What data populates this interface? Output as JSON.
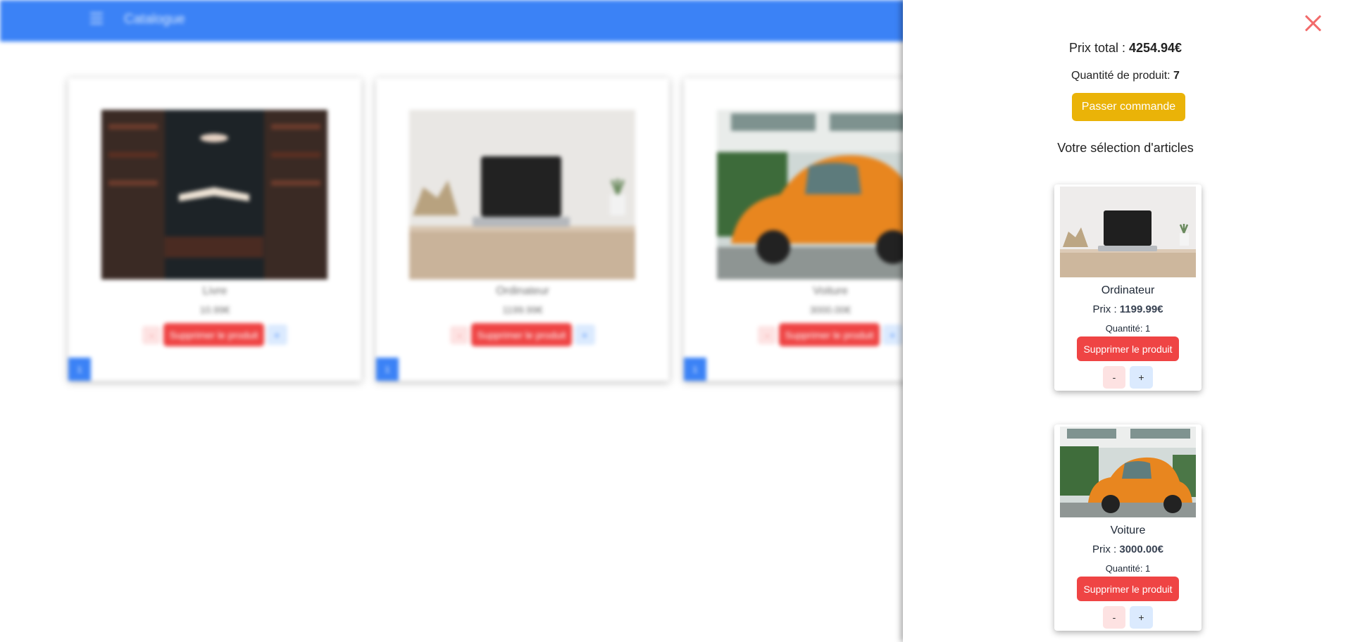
{
  "topbar": {
    "menu_icon": "hamburger-menu-icon",
    "title": "Catalogue",
    "color": "#3b82f6"
  },
  "catalogue": {
    "products": [
      {
        "name": "Livre",
        "price": "10.99€",
        "minus": "-",
        "delete": "Supprimer le produit",
        "plus": "+",
        "quantity": "1",
        "image": "book-photo"
      },
      {
        "name": "Ordinateur",
        "price": "1199.99€",
        "minus": "-",
        "delete": "Supprimer le produit",
        "plus": "+",
        "quantity": "1",
        "image": "laptop-photo"
      },
      {
        "name": "Voiture",
        "price": "3000.00€",
        "minus": "-",
        "delete": "Supprimer le produit",
        "plus": "+",
        "quantity": "1",
        "image": "orange-car-photo"
      }
    ]
  },
  "cart": {
    "close_icon": "close-icon",
    "total_label": "Prix total : ",
    "total_value": "4254.94€",
    "quantity_label": "Quantité de produit: ",
    "quantity_value": "7",
    "order_button": "Passer commande",
    "selection_title": "Votre sélection d'articles",
    "items": [
      {
        "name": "Ordinateur",
        "price_label": "Prix : ",
        "price": "1199.99€",
        "quantity": "Quantité: 1",
        "delete": "Supprimer le produit",
        "minus": "-",
        "plus": "+",
        "image": "laptop-photo"
      },
      {
        "name": "Voiture",
        "price_label": "Prix : ",
        "price": "3000.00€",
        "quantity": "Quantité: 1",
        "delete": "Supprimer le produit",
        "minus": "-",
        "plus": "+",
        "image": "orange-car-photo"
      }
    ]
  },
  "colors": {
    "primary": "#3b82f6",
    "danger": "#ef4444",
    "warning": "#eab308",
    "close": "#f26b6b"
  }
}
